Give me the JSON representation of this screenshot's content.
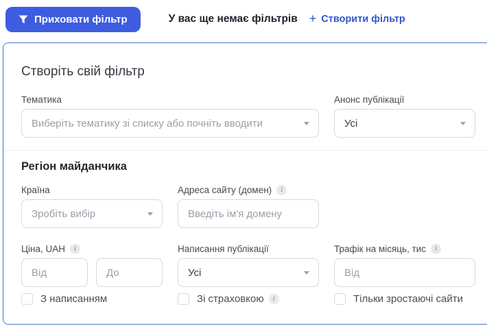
{
  "colors": {
    "primary_button": "#3d5ce0",
    "panel_border": "#4a74cd",
    "link_blue": "#3156c8",
    "input_border": "#d5d8dd",
    "placeholder_gray": "#9aa0a8"
  },
  "topbar": {
    "hide_filter_button": "Приховати фільтр",
    "status_text": "У вас ще немає фільтрів",
    "plus_icon": "+",
    "create_filter_link": "Створити фільтр"
  },
  "panel": {
    "title": "Створіть свій фільтр",
    "topic": {
      "label": "Тематика",
      "placeholder": "Виберіть тематику зі списку або почніть вводити"
    },
    "announcement": {
      "label": "Анонс публікації",
      "value": "Усі"
    },
    "region": {
      "heading": "Регіон майданчика",
      "country": {
        "label": "Країна",
        "placeholder": "Зробіть вибір"
      },
      "domain": {
        "label": "Адреса сайту (домен)",
        "placeholder": "Введіть ім'я домену"
      },
      "price": {
        "label": "Ціна, UAH",
        "from_placeholder": "Від",
        "to_placeholder": "До"
      },
      "writing": {
        "label": "Написання публікації",
        "value": "Усі"
      },
      "traffic": {
        "label": "Трафік на місяць, тис",
        "from_placeholder": "Від"
      },
      "checkboxes": [
        {
          "label": "З написанням",
          "checked": false
        },
        {
          "label": "Зі страховкою",
          "checked": false
        },
        {
          "label": "Тільки зростаючі сайти",
          "checked": false
        }
      ]
    }
  }
}
